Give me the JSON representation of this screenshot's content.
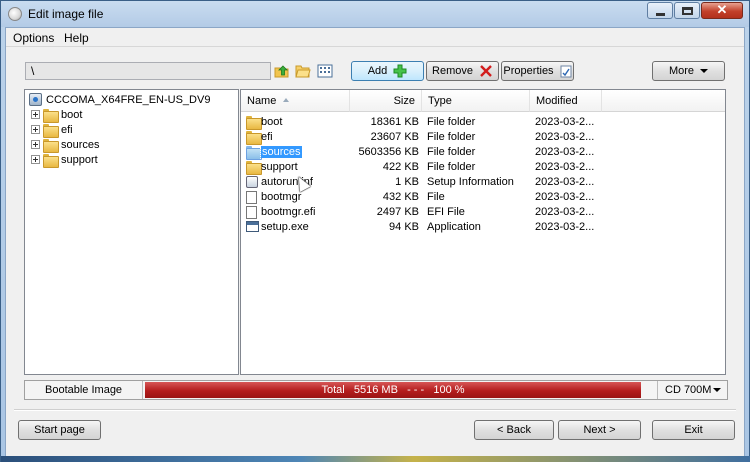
{
  "window": {
    "title": "Edit image file"
  },
  "menu": [
    "Options",
    "Help"
  ],
  "toolbar": {
    "path": "\\",
    "add_label": "Add",
    "remove_label": "Remove",
    "properties_label": "Properties",
    "more_label": "More"
  },
  "tree": {
    "root": "CCCOMA_X64FRE_EN-US_DV9",
    "items": [
      "boot",
      "efi",
      "sources",
      "support"
    ]
  },
  "list": {
    "columns": [
      "Name",
      "Size",
      "Type",
      "Modified"
    ],
    "rows": [
      {
        "name": "boot",
        "size": "18361 KB",
        "type": "File folder",
        "modified": "2023-03-2...",
        "icon": "folder-icon"
      },
      {
        "name": "efi",
        "size": "23607 KB",
        "type": "File folder",
        "modified": "2023-03-2...",
        "icon": "folder-icon"
      },
      {
        "name": "sources",
        "size": "5603356 KB",
        "type": "File folder",
        "modified": "2023-03-2...",
        "icon": "folder-icon"
      },
      {
        "name": "support",
        "size": "422 KB",
        "type": "File folder",
        "modified": "2023-03-2...",
        "icon": "folder-icon"
      },
      {
        "name": "autorun.inf",
        "size": "1 KB",
        "type": "Setup Information",
        "modified": "2023-03-2...",
        "icon": "setup-file-icon"
      },
      {
        "name": "bootmgr",
        "size": "432 KB",
        "type": "File",
        "modified": "2023-03-2...",
        "icon": "file-icon"
      },
      {
        "name": "bootmgr.efi",
        "size": "2497 KB",
        "type": "EFI File",
        "modified": "2023-03-2...",
        "icon": "file-icon"
      },
      {
        "name": "setup.exe",
        "size": "94 KB",
        "type": "Application",
        "modified": "2023-03-2...",
        "icon": "application-icon"
      }
    ],
    "selected_index": 2
  },
  "status": {
    "bootable_label": "Bootable Image",
    "progress_text": "Total   5516 MB   - - -   100 %",
    "progress_fraction": 1.0,
    "media": "CD 700M"
  },
  "footer": {
    "start_label": "Start page",
    "back_label": "< Back",
    "next_label": "Next >",
    "exit_label": "Exit"
  },
  "colors": {
    "progress": "#b41d1d",
    "selection": "#3399ff"
  }
}
